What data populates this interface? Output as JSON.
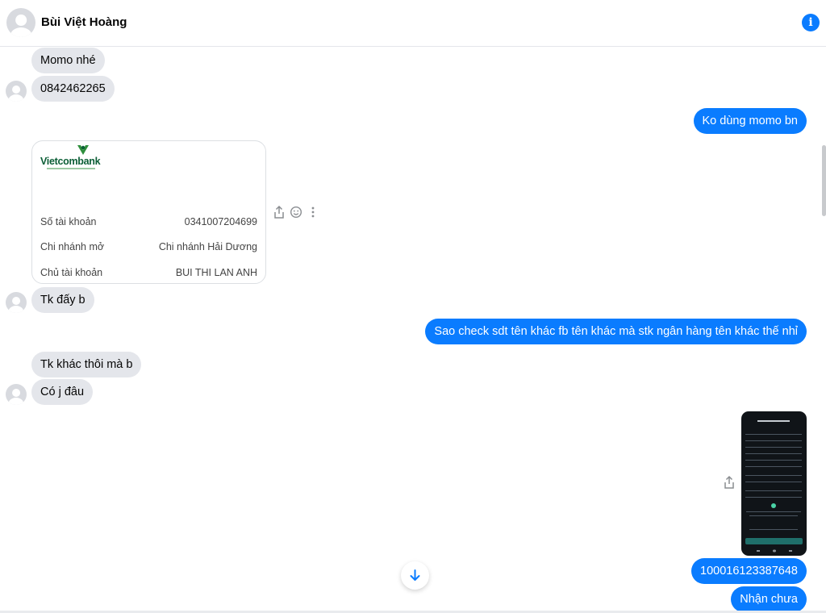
{
  "header": {
    "contact_name": "Bùi Việt Hoàng",
    "avatar_icon": "default-avatar-icon",
    "info_icon": "info-icon",
    "info_glyph": "i"
  },
  "messages": {
    "m1": "Momo nhé",
    "m2": "0842462265",
    "m3": "Ko dùng momo bn",
    "m4": "Tk đấy b",
    "m5": "Sao check sdt tên khác fb tên khác mà stk ngân hàng tên khác thế nhỉ",
    "m6": "Tk khác thôi mà b",
    "m7": "Có j đâu",
    "m8": "100016123387648",
    "m9": "Nhận chưa"
  },
  "bank_card": {
    "bank_name": "Vietcombank",
    "rows": [
      {
        "label": "Số tài khoản",
        "value": "0341007204699"
      },
      {
        "label": "Chi nhánh mở",
        "value": "Chi nhánh Hải Dương"
      },
      {
        "label": "Chủ tài khoản",
        "value": "BUI THI LAN ANH"
      }
    ]
  },
  "actions": {
    "share_icon": "share-icon",
    "react_icon": "emoji-icon",
    "more_icon": "more-vertical-icon"
  },
  "colors": {
    "outgoing_bubble": "#0a7cff",
    "incoming_bubble": "#e4e6eb",
    "brand_green": "#0b5e36"
  }
}
